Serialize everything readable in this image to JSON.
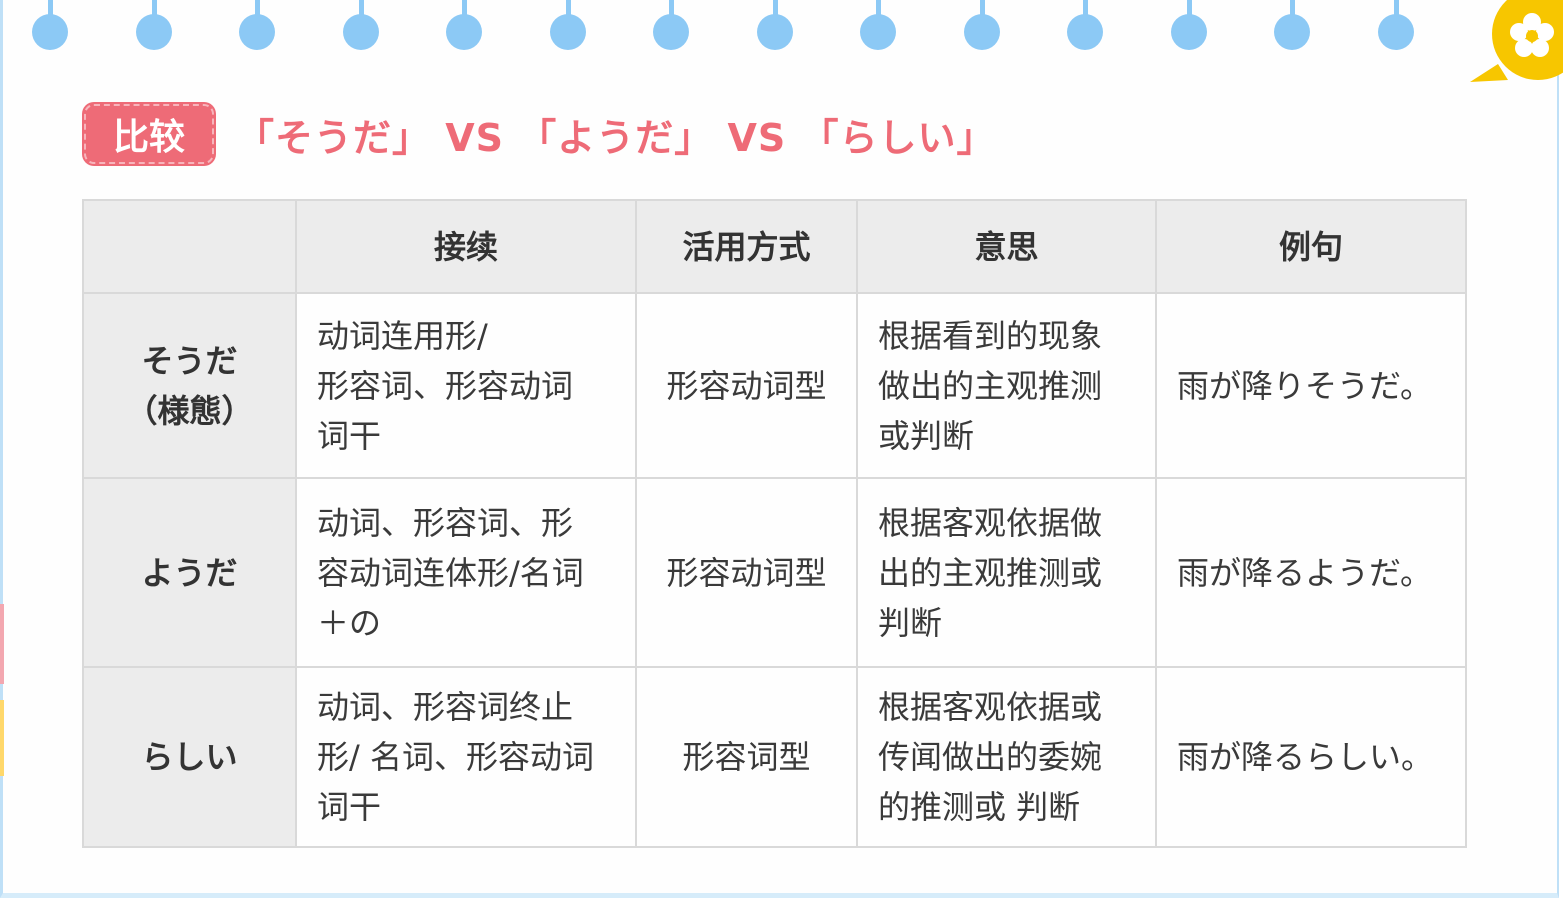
{
  "title": {
    "tag": "比较",
    "text": "「そうだ」 VS 「ようだ」 VS 「らしい」"
  },
  "table": {
    "headers": [
      "",
      "接续",
      "活用方式",
      "意思",
      "例句"
    ],
    "rows": [
      {
        "head": "そうだ\n（様態）",
        "connect": "动词连用形/\n形容词、形容动词\n词干",
        "conjugation": "形容动词型",
        "meaning": "根据看到的现象\n做出的主观推测\n或判断",
        "example": "雨が降りそうだ。"
      },
      {
        "head": "ようだ",
        "connect": "动词、形容词、形\n容动词连体形/名词\n＋の",
        "conjugation": "形容动词型",
        "meaning": "根据客观依据做\n出的主观推测或\n判断",
        "example": "雨が降るようだ。"
      },
      {
        "head": "らしい",
        "connect": "动词、形容词终止\n形/ 名词、形容动词\n词干",
        "conjugation": "形容词型",
        "meaning": "根据客观依据或\n传闻做出的委婉\n的推测或 判断",
        "example": "雨が降るらしい。"
      }
    ]
  },
  "colors": {
    "accent": "#ee6b77",
    "ring": "#8cc9f5",
    "header_bg": "#ececec",
    "badge": "#f7c600"
  },
  "icons": {
    "corner": "flower-badge-icon",
    "rings": "binder-ring-icon"
  }
}
